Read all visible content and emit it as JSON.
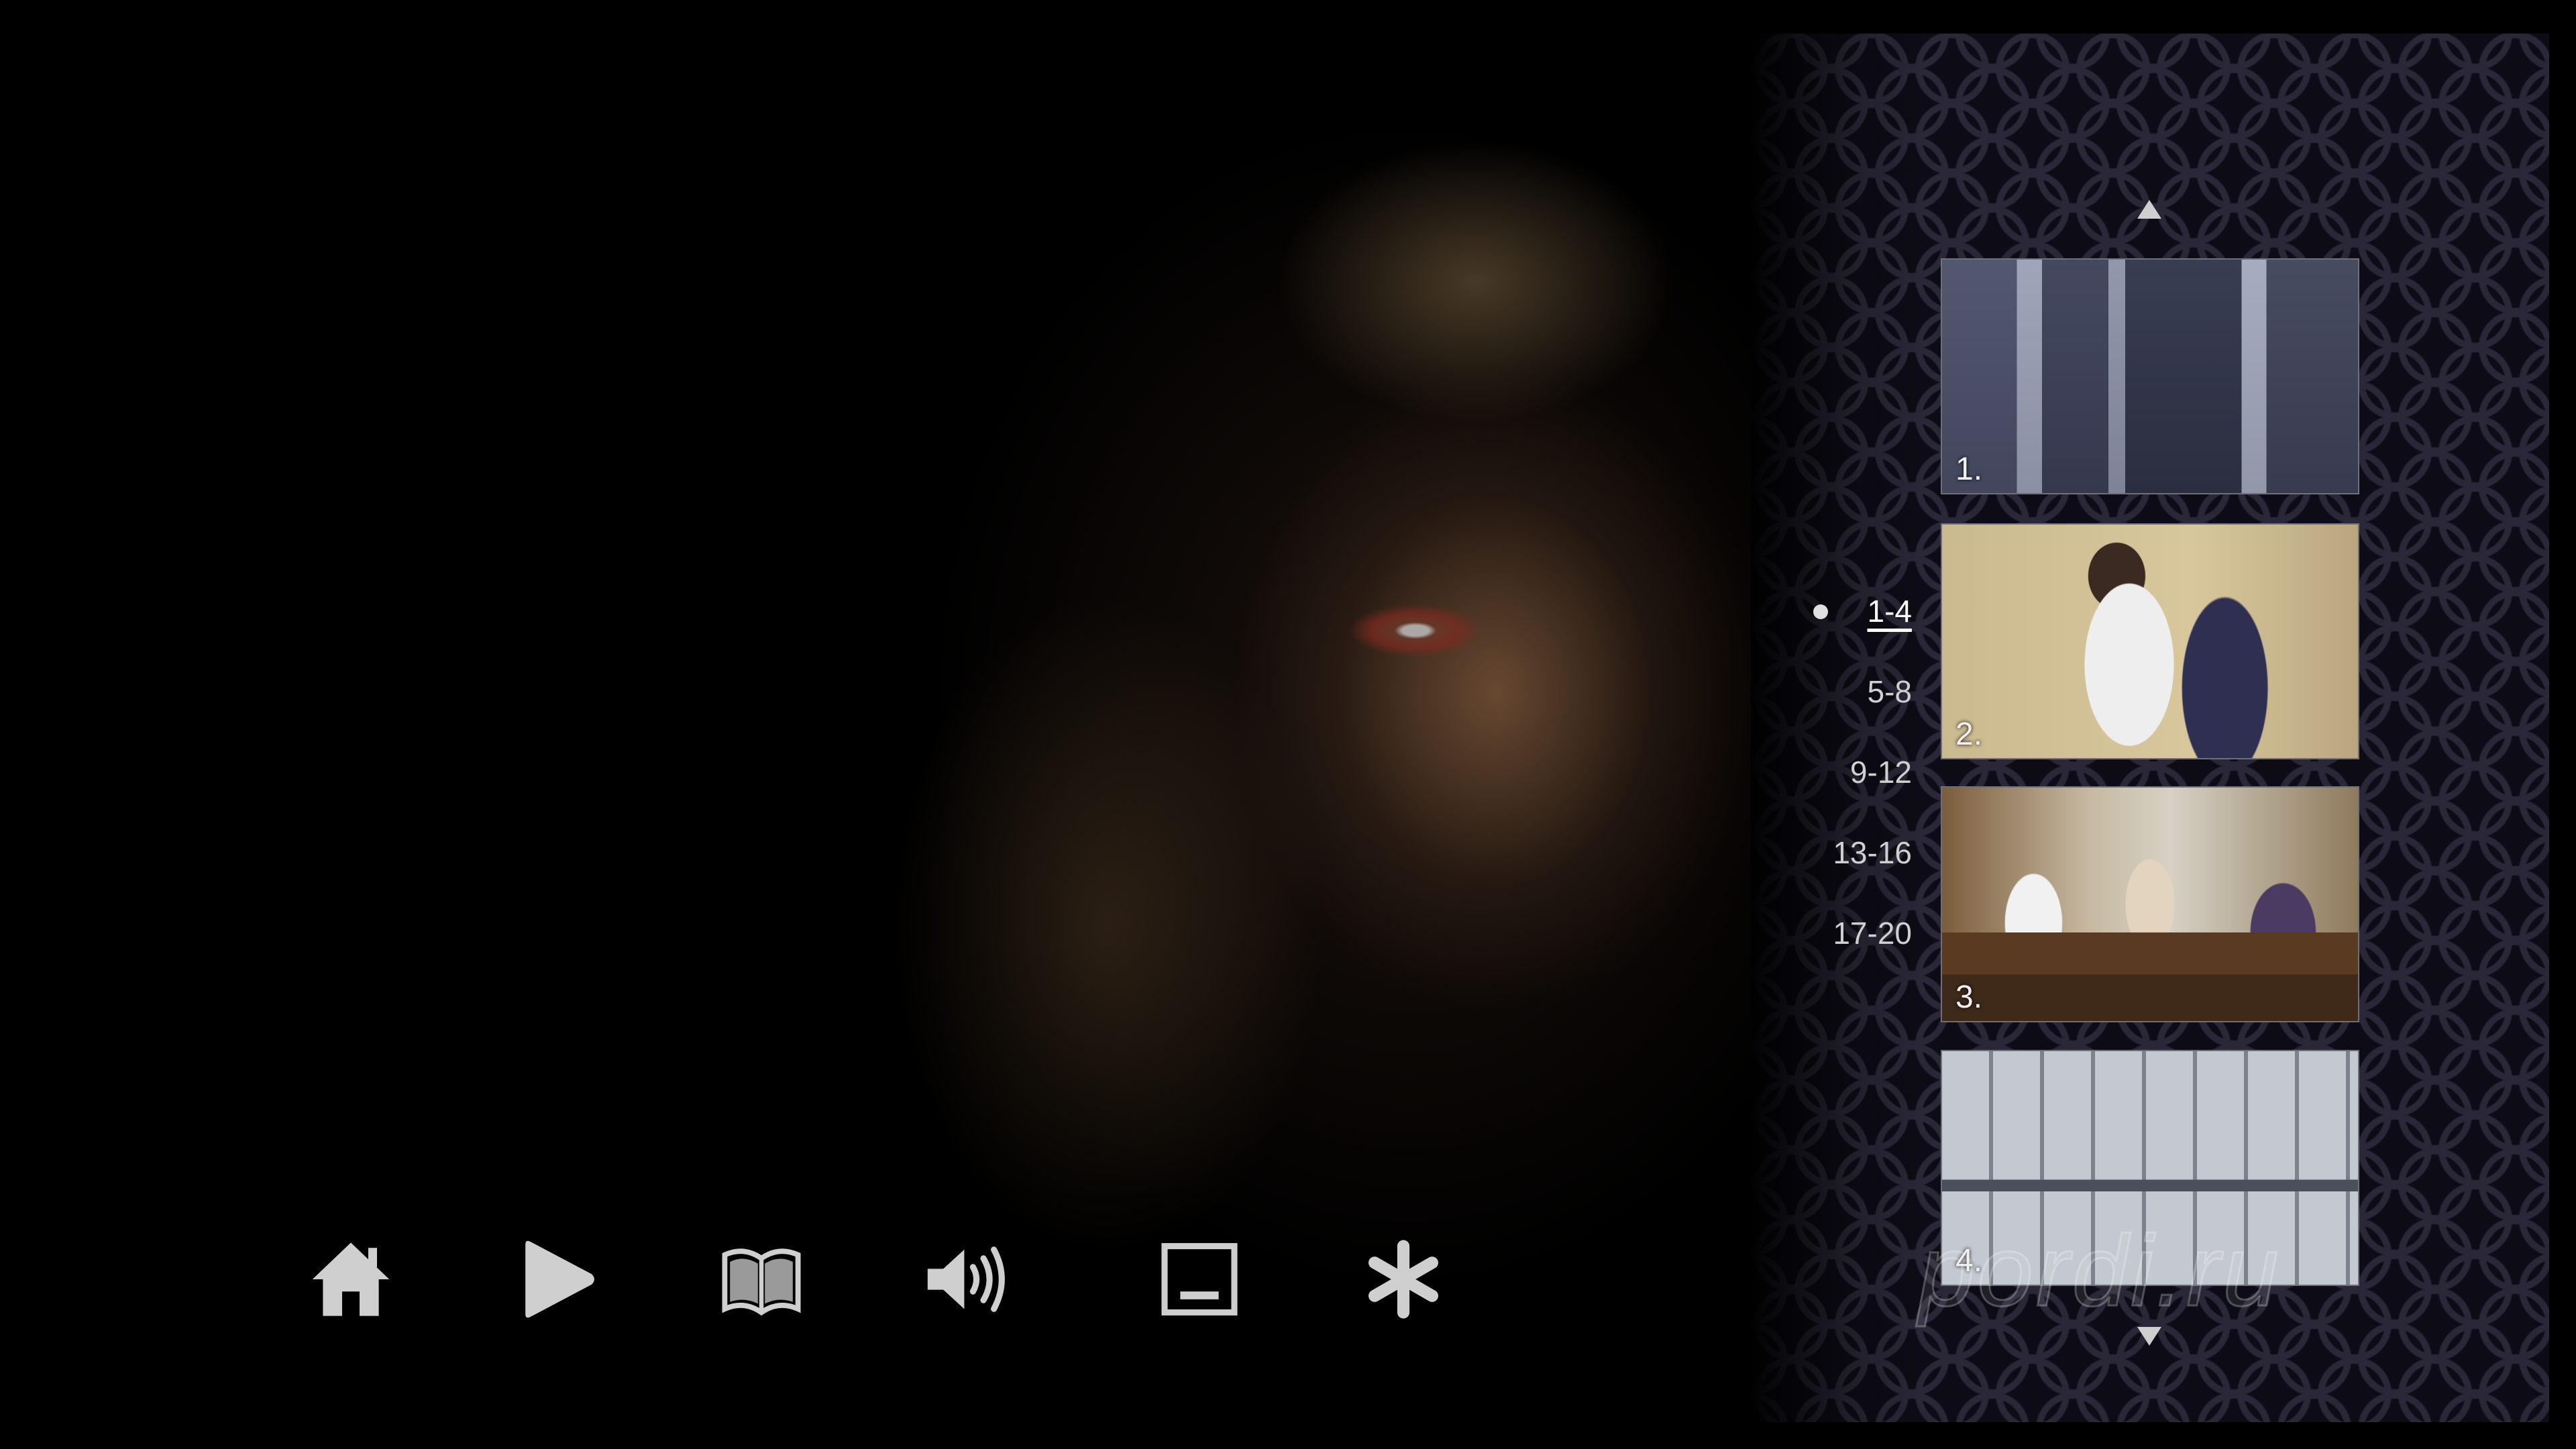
{
  "menu": {
    "navigation": [
      {
        "icon": "home-icon"
      },
      {
        "icon": "play-icon"
      },
      {
        "icon": "chapters-book-icon"
      },
      {
        "icon": "audio-speaker-icon"
      },
      {
        "icon": "subtitles-icon"
      },
      {
        "icon": "extras-asterisk-icon"
      }
    ],
    "chapter_ranges": [
      "1-4",
      "5-8",
      "9-12",
      "13-16",
      "17-20"
    ],
    "selected_range": "1-4",
    "chapters": [
      {
        "label": "1."
      },
      {
        "label": "2."
      },
      {
        "label": "3."
      },
      {
        "label": "4."
      }
    ],
    "watermark": "pordi.ru"
  },
  "colors": {
    "icon": "#cfcfcf",
    "panel": "#0d0c16",
    "hex_pattern": "#2a2838"
  }
}
